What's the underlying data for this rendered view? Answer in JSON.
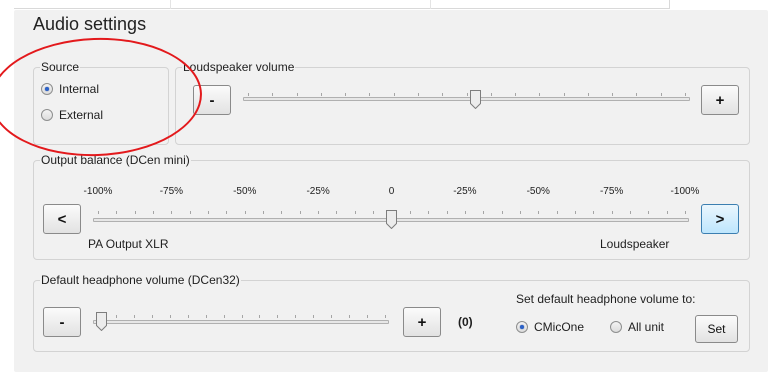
{
  "title": "Audio settings",
  "source": {
    "legend": "Source",
    "options": [
      {
        "label": "Internal",
        "selected": true
      },
      {
        "label": "External",
        "selected": false
      }
    ]
  },
  "loudspeaker": {
    "legend": "Loudspeaker volume",
    "minus_label": "-",
    "plus_label": "+",
    "level": 0.52
  },
  "balance": {
    "legend": "Output balance (DCen mini)",
    "scale": [
      "-100%",
      "-75%",
      "-50%",
      "-25%",
      "0",
      "-25%",
      "-50%",
      "-75%",
      "-100%"
    ],
    "left_button": "<",
    "right_button": ">",
    "left_label": "PA Output XLR",
    "right_label": "Loudspeaker",
    "level": 0.5
  },
  "headphone": {
    "legend": "Default headphone volume (DCen32)",
    "minus_label": "-",
    "plus_label": "+",
    "value_text": "(0)",
    "level": 0.0,
    "default_prompt": "Set default headphone volume to:",
    "options": [
      {
        "label": "CMicOne",
        "selected": true
      },
      {
        "label": "All unit",
        "selected": false
      }
    ],
    "set_label": "Set"
  },
  "colors": {
    "panel": "#f1f1f1",
    "accent_selected": "#2c62c8",
    "annotation_circle": "#e3191c"
  }
}
